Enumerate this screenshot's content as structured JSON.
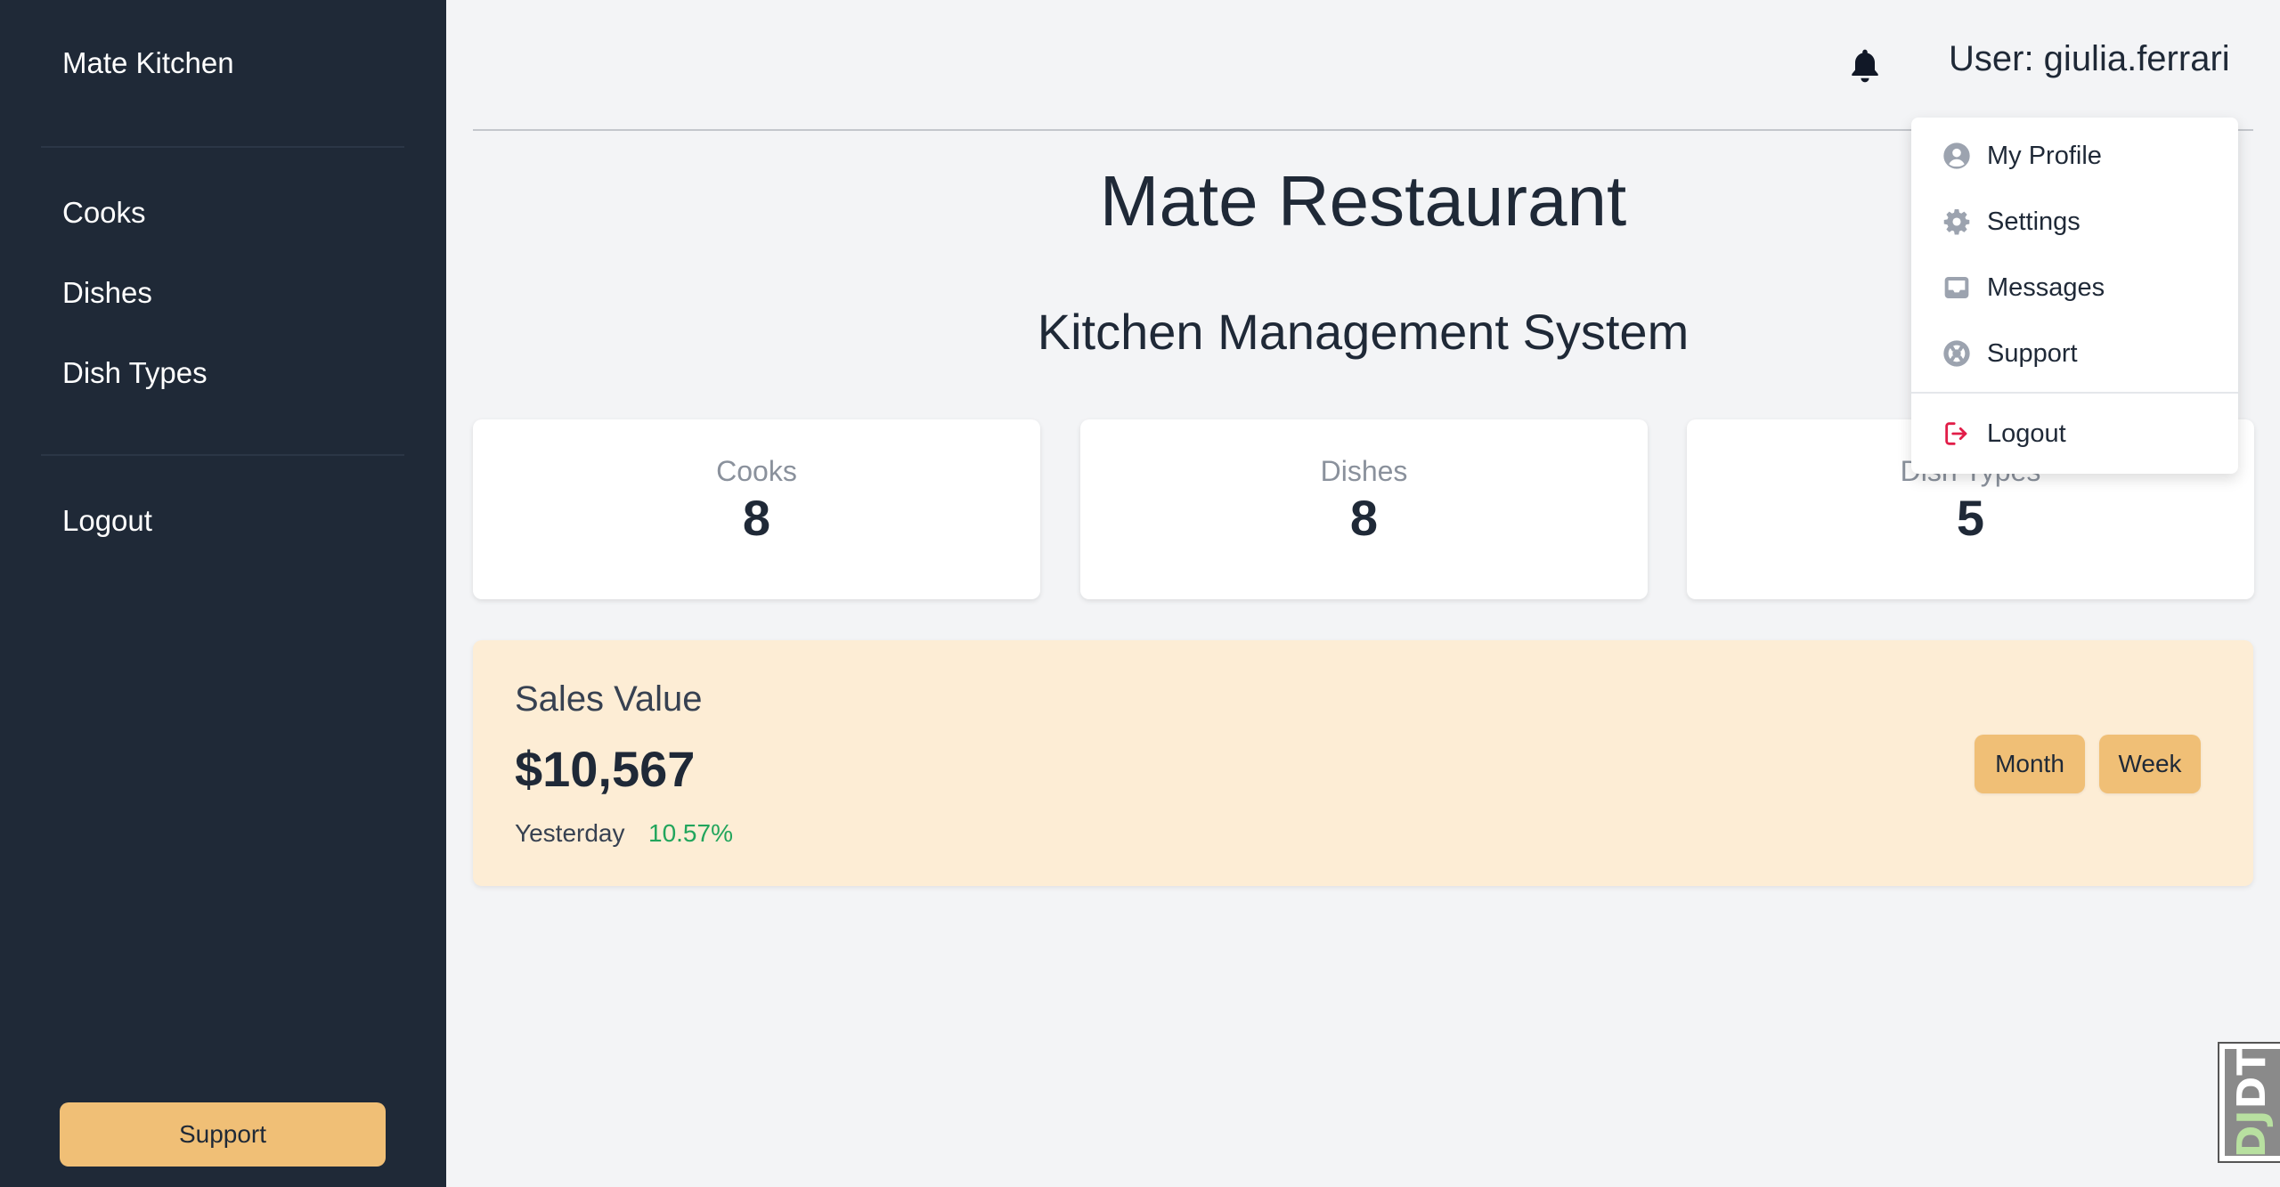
{
  "sidebar": {
    "brand": "Mate Kitchen",
    "nav": {
      "cooks": "Cooks",
      "dishes": "Dishes",
      "dish_types": "Dish Types"
    },
    "logout": "Logout",
    "support_button": "Support"
  },
  "header": {
    "bell_icon": "bell-icon",
    "user_label": "User: giulia.ferrari"
  },
  "main": {
    "title": "Mate Restaurant",
    "subtitle": "Kitchen Management System",
    "stats": {
      "cooks": {
        "label": "Cooks",
        "value": "8"
      },
      "dishes": {
        "label": "Dishes",
        "value": "8"
      },
      "dish_types": {
        "label": "Dish Types",
        "value": "5"
      }
    },
    "sales": {
      "title": "Sales Value",
      "value": "$10,567",
      "period": "Yesterday",
      "change": "10.57%",
      "change_color": "#22a55c",
      "buttons": {
        "month": "Month",
        "week": "Week"
      }
    }
  },
  "dropdown": {
    "items": {
      "profile": {
        "label": "My Profile",
        "icon": "user-circle-icon"
      },
      "settings": {
        "label": "Settings",
        "icon": "gear-icon"
      },
      "messages": {
        "label": "Messages",
        "icon": "inbox-icon"
      },
      "support": {
        "label": "Support",
        "icon": "lifebuoy-icon"
      },
      "logout": {
        "label": "Logout",
        "icon": "logout-icon"
      }
    }
  },
  "debug_toolbar": {
    "label_dj": "DJ",
    "label_dt": "DT"
  },
  "colors": {
    "sidebar_bg": "#1f2937",
    "accent": "#f0bf76",
    "sales_bg": "#fdedd5",
    "logout_icon": "#e11d48"
  }
}
